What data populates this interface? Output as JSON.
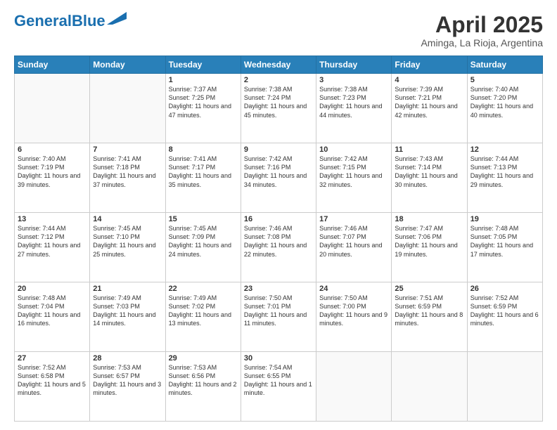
{
  "logo": {
    "part1": "General",
    "part2": "Blue"
  },
  "title": "April 2025",
  "subtitle": "Aminga, La Rioja, Argentina",
  "days_header": [
    "Sunday",
    "Monday",
    "Tuesday",
    "Wednesday",
    "Thursday",
    "Friday",
    "Saturday"
  ],
  "weeks": [
    [
      {
        "num": "",
        "detail": ""
      },
      {
        "num": "",
        "detail": ""
      },
      {
        "num": "1",
        "detail": "Sunrise: 7:37 AM\nSunset: 7:25 PM\nDaylight: 11 hours and 47 minutes."
      },
      {
        "num": "2",
        "detail": "Sunrise: 7:38 AM\nSunset: 7:24 PM\nDaylight: 11 hours and 45 minutes."
      },
      {
        "num": "3",
        "detail": "Sunrise: 7:38 AM\nSunset: 7:23 PM\nDaylight: 11 hours and 44 minutes."
      },
      {
        "num": "4",
        "detail": "Sunrise: 7:39 AM\nSunset: 7:21 PM\nDaylight: 11 hours and 42 minutes."
      },
      {
        "num": "5",
        "detail": "Sunrise: 7:40 AM\nSunset: 7:20 PM\nDaylight: 11 hours and 40 minutes."
      }
    ],
    [
      {
        "num": "6",
        "detail": "Sunrise: 7:40 AM\nSunset: 7:19 PM\nDaylight: 11 hours and 39 minutes."
      },
      {
        "num": "7",
        "detail": "Sunrise: 7:41 AM\nSunset: 7:18 PM\nDaylight: 11 hours and 37 minutes."
      },
      {
        "num": "8",
        "detail": "Sunrise: 7:41 AM\nSunset: 7:17 PM\nDaylight: 11 hours and 35 minutes."
      },
      {
        "num": "9",
        "detail": "Sunrise: 7:42 AM\nSunset: 7:16 PM\nDaylight: 11 hours and 34 minutes."
      },
      {
        "num": "10",
        "detail": "Sunrise: 7:42 AM\nSunset: 7:15 PM\nDaylight: 11 hours and 32 minutes."
      },
      {
        "num": "11",
        "detail": "Sunrise: 7:43 AM\nSunset: 7:14 PM\nDaylight: 11 hours and 30 minutes."
      },
      {
        "num": "12",
        "detail": "Sunrise: 7:44 AM\nSunset: 7:13 PM\nDaylight: 11 hours and 29 minutes."
      }
    ],
    [
      {
        "num": "13",
        "detail": "Sunrise: 7:44 AM\nSunset: 7:12 PM\nDaylight: 11 hours and 27 minutes."
      },
      {
        "num": "14",
        "detail": "Sunrise: 7:45 AM\nSunset: 7:10 PM\nDaylight: 11 hours and 25 minutes."
      },
      {
        "num": "15",
        "detail": "Sunrise: 7:45 AM\nSunset: 7:09 PM\nDaylight: 11 hours and 24 minutes."
      },
      {
        "num": "16",
        "detail": "Sunrise: 7:46 AM\nSunset: 7:08 PM\nDaylight: 11 hours and 22 minutes."
      },
      {
        "num": "17",
        "detail": "Sunrise: 7:46 AM\nSunset: 7:07 PM\nDaylight: 11 hours and 20 minutes."
      },
      {
        "num": "18",
        "detail": "Sunrise: 7:47 AM\nSunset: 7:06 PM\nDaylight: 11 hours and 19 minutes."
      },
      {
        "num": "19",
        "detail": "Sunrise: 7:48 AM\nSunset: 7:05 PM\nDaylight: 11 hours and 17 minutes."
      }
    ],
    [
      {
        "num": "20",
        "detail": "Sunrise: 7:48 AM\nSunset: 7:04 PM\nDaylight: 11 hours and 16 minutes."
      },
      {
        "num": "21",
        "detail": "Sunrise: 7:49 AM\nSunset: 7:03 PM\nDaylight: 11 hours and 14 minutes."
      },
      {
        "num": "22",
        "detail": "Sunrise: 7:49 AM\nSunset: 7:02 PM\nDaylight: 11 hours and 13 minutes."
      },
      {
        "num": "23",
        "detail": "Sunrise: 7:50 AM\nSunset: 7:01 PM\nDaylight: 11 hours and 11 minutes."
      },
      {
        "num": "24",
        "detail": "Sunrise: 7:50 AM\nSunset: 7:00 PM\nDaylight: 11 hours and 9 minutes."
      },
      {
        "num": "25",
        "detail": "Sunrise: 7:51 AM\nSunset: 6:59 PM\nDaylight: 11 hours and 8 minutes."
      },
      {
        "num": "26",
        "detail": "Sunrise: 7:52 AM\nSunset: 6:59 PM\nDaylight: 11 hours and 6 minutes."
      }
    ],
    [
      {
        "num": "27",
        "detail": "Sunrise: 7:52 AM\nSunset: 6:58 PM\nDaylight: 11 hours and 5 minutes."
      },
      {
        "num": "28",
        "detail": "Sunrise: 7:53 AM\nSunset: 6:57 PM\nDaylight: 11 hours and 3 minutes."
      },
      {
        "num": "29",
        "detail": "Sunrise: 7:53 AM\nSunset: 6:56 PM\nDaylight: 11 hours and 2 minutes."
      },
      {
        "num": "30",
        "detail": "Sunrise: 7:54 AM\nSunset: 6:55 PM\nDaylight: 11 hours and 1 minute."
      },
      {
        "num": "",
        "detail": ""
      },
      {
        "num": "",
        "detail": ""
      },
      {
        "num": "",
        "detail": ""
      }
    ]
  ]
}
